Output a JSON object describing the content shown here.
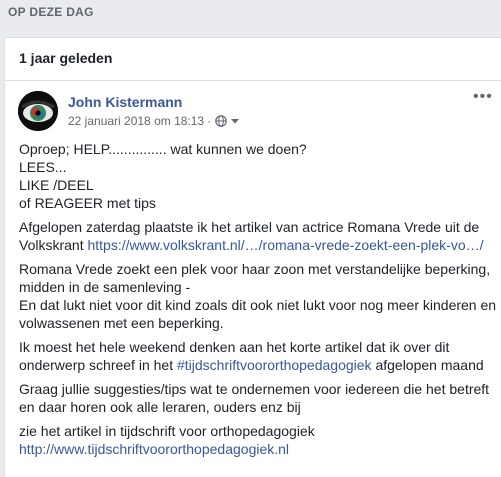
{
  "section": {
    "title": "OP DEZE DAG"
  },
  "card": {
    "title": "1 jaar geleden",
    "author": "John Kistermann",
    "timestamp": "22 januari 2018 om 18:13",
    "separator": "·",
    "more_label": "•••",
    "privacy_icon": "globe-icon",
    "audience_icon": "caret-down-icon",
    "paragraphs": {
      "p1": {
        "l1": "Oproep; HELP............... wat kunnen we doen?",
        "l2": "LEES...",
        "l3": "LIKE /DEEL",
        "l4": "of REAGEER met tips"
      },
      "p2": {
        "text": "Afgelopen zaterdag plaatste ik het artikel van actrice Romana Vrede uit de Volkskrant ",
        "link": "https://www.volkskrant.nl/…/romana-vrede-zoekt-een-plek-vo…/"
      },
      "p3": {
        "l1": "Romana Vrede zoekt een plek voor haar zoon met verstandelijke beperking, midden in de samenleving -",
        "l2": "En dat lukt niet voor dit kind zoals dit ook niet lukt voor nog meer kinderen en volwassenen met een beperking."
      },
      "p4": {
        "text": "Ik moest het hele weekend denken aan het korte artikel dat ik over dit onderwerp schreef in het ",
        "hashtag": "#tijdschriftvoororthopedagogiek",
        "text_after": " afgelopen maand"
      },
      "p5": {
        "text": "Graag jullie suggesties/tips wat te ondernemen voor iedereen die het betreft en daar horen ook alle leraren, ouders enz bij"
      },
      "p6": {
        "text": "zie het artikel in tijdschrift voor orthopedagogiek",
        "link": "http://www.tijdschriftvoororthopedagogiek.nl"
      }
    }
  }
}
